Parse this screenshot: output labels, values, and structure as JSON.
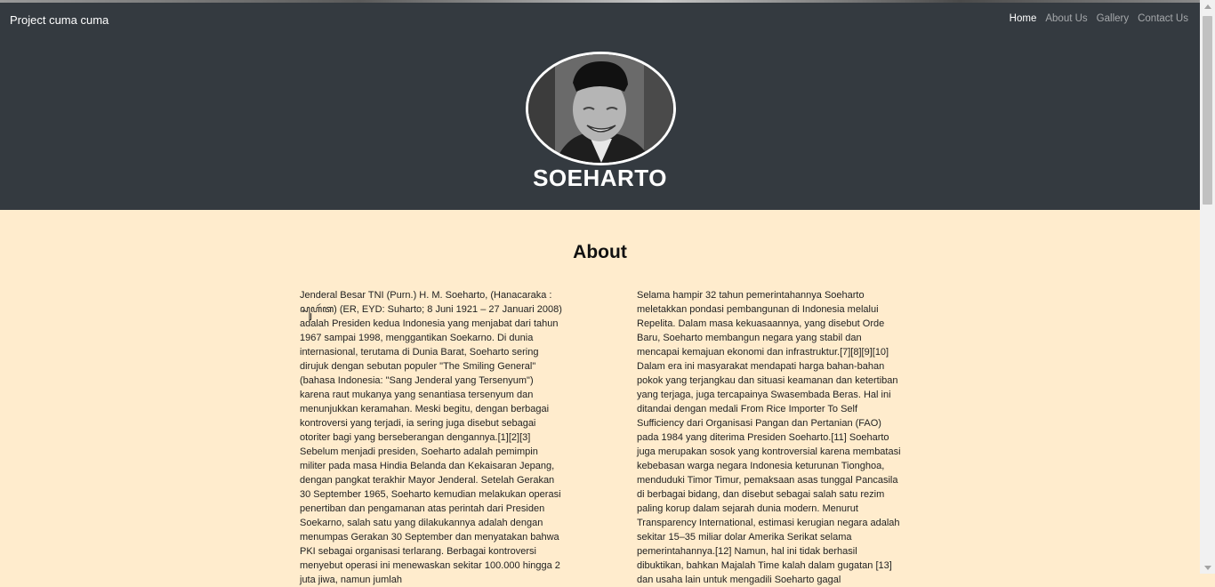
{
  "navbar": {
    "brand": "Project cuma cuma",
    "links": [
      "Home",
      "About Us",
      "Gallery",
      "Contact Us"
    ]
  },
  "hero": {
    "title": "SOEHARTO"
  },
  "about": {
    "heading": "About",
    "col1": "Jenderal Besar TNI (Purn.) H. M. Soeharto, (Hanacaraka : ꦱꦸꦲꦂꦠ) (ER, EYD: Suharto; 8 Juni 1921 – 27 Januari 2008) adalah Presiden kedua Indonesia yang menjabat dari tahun 1967 sampai 1998, menggantikan Soekarno. Di dunia internasional, terutama di Dunia Barat, Soeharto sering dirujuk dengan sebutan populer \"The Smiling General\" (bahasa Indonesia: \"Sang Jenderal yang Tersenyum\") karena raut mukanya yang senantiasa tersenyum dan menunjukkan keramahan. Meski begitu, dengan berbagai kontroversi yang terjadi, ia sering juga disebut sebagai otoriter bagi yang berseberangan dengannya.[1][2][3] Sebelum menjadi presiden, Soeharto adalah pemimpin militer pada masa Hindia Belanda dan Kekaisaran Jepang, dengan pangkat terakhir Mayor Jenderal. Setelah Gerakan 30 September 1965, Soeharto kemudian melakukan operasi penertiban dan pengamanan atas perintah dari Presiden Soekarno, salah satu yang dilakukannya adalah dengan menumpas Gerakan 30 September dan menyatakan bahwa PKI sebagai organisasi terlarang. Berbagai kontroversi menyebut operasi ini menewaskan sekitar 100.000 hingga 2 juta jiwa, namun jumlah",
    "col2": "Selama hampir 32 tahun pemerintahannya Soeharto meletakkan pondasi pembangunan di Indonesia melalui Repelita. Dalam masa kekuasaannya, yang disebut Orde Baru, Soeharto membangun negara yang stabil dan mencapai kemajuan ekonomi dan infrastruktur.[7][8][9][10] Dalam era ini masyarakat mendapati harga bahan-bahan pokok yang terjangkau dan situasi keamanan dan ketertiban yang terjaga, juga tercapainya Swasembada Beras. Hal ini ditandai dengan medali From Rice Importer To Self Sufficiency dari Organisasi Pangan dan Pertanian (FAO) pada 1984 yang diterima Presiden Soeharto.[11] Soeharto juga merupakan sosok yang kontroversial karena membatasi kebebasan warga negara Indonesia keturunan Tionghoa, menduduki Timor Timur, pemaksaan asas tunggal Pancasila di berbagai bidang, dan disebut sebagai salah satu rezim paling korup dalam sejarah dunia modern. Menurut Transparency International, estimasi kerugian negara adalah sekitar 15–35 miliar dolar Amerika Serikat selama pemerintahannya.[12] Namun, hal ini tidak berhasil dibuktikan, bahkan Majalah Time kalah dalam gugatan [13] dan usaha lain untuk mengadili Soeharto gagal"
  }
}
